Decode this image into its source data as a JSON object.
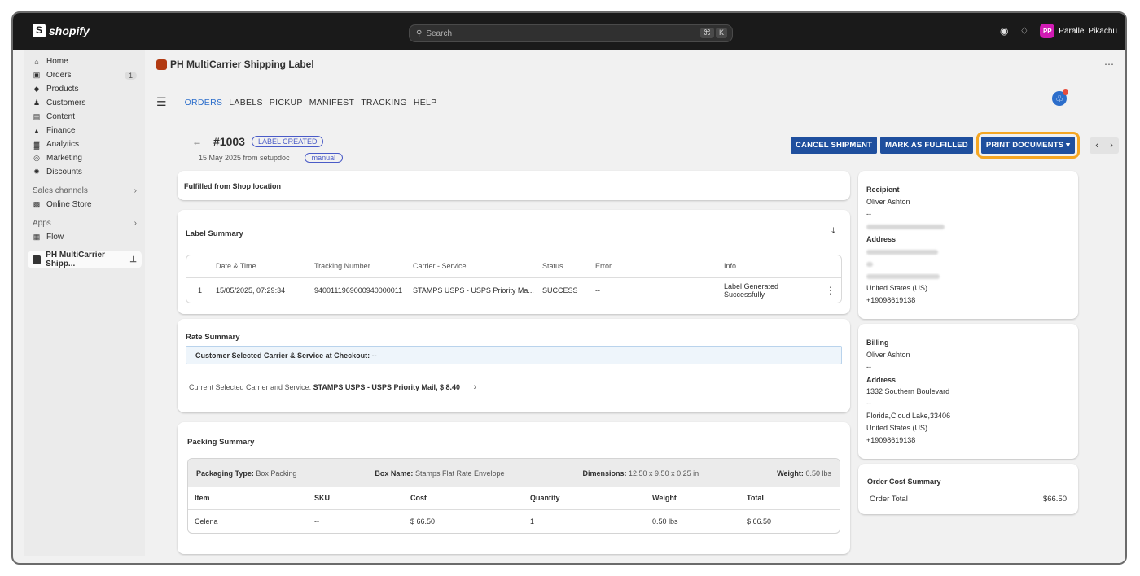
{
  "topbar": {
    "brand": "shopify",
    "search_placeholder": "Search",
    "shortcut_keys": [
      "⌘",
      "K"
    ],
    "user_initials": "PP",
    "user_name": "Parallel Pikachu"
  },
  "sidebar": {
    "items": [
      {
        "label": "Home",
        "icon": "home-icon"
      },
      {
        "label": "Orders",
        "icon": "orders-icon",
        "count": "1"
      },
      {
        "label": "Products",
        "icon": "tag-icon"
      },
      {
        "label": "Customers",
        "icon": "person-icon"
      },
      {
        "label": "Content",
        "icon": "content-icon"
      },
      {
        "label": "Finance",
        "icon": "bank-icon"
      },
      {
        "label": "Analytics",
        "icon": "chart-icon"
      },
      {
        "label": "Marketing",
        "icon": "target-icon"
      },
      {
        "label": "Discounts",
        "icon": "discount-icon"
      }
    ],
    "sales_channels_label": "Sales channels",
    "online_store": "Online Store",
    "apps_label": "Apps",
    "flow": "Flow",
    "active_app": "PH MultiCarrier Shipp..."
  },
  "app": {
    "title": "PH MultiCarrier Shipping Label",
    "menu": [
      "ORDERS",
      "LABELS",
      "PICKUP",
      "MANIFEST",
      "TRACKING",
      "HELP"
    ]
  },
  "order": {
    "id": "#1003",
    "status_badge": "LABEL CREATED",
    "date_line": "15 May 2025 from setupdoc",
    "manual_badge": "manual",
    "actions": [
      "CANCEL SHIPMENT",
      "MARK AS FULFILLED",
      "PRINT DOCUMENTS"
    ]
  },
  "fulfilled": "Fulfilled from Shop location",
  "label_summary": {
    "title": "Label Summary",
    "columns": [
      "Date & Time",
      "Tracking Number",
      "Carrier - Service",
      "Status",
      "Error",
      "Info"
    ],
    "row": {
      "index": "1",
      "datetime": "15/05/2025, 07:29:34",
      "tracking": "9400111969000940000011",
      "carrier": "STAMPS USPS - USPS Priority Ma...",
      "status": "SUCCESS",
      "error": "--",
      "info": "Label Generated Successfully"
    }
  },
  "rate_summary": {
    "title": "Rate Summary",
    "checkout_line": "Customer Selected Carrier & Service at Checkout: --",
    "current_label": "Current Selected Carrier and Service:",
    "current_value": "STAMPS USPS - USPS Priority Mail, $ 8.40"
  },
  "packing_summary": {
    "title": "Packing Summary",
    "packaging_type_label": "Packaging Type:",
    "packaging_type": "Box Packing",
    "box_name_label": "Box Name:",
    "box_name": "Stamps Flat Rate Envelope",
    "dimensions_label": "Dimensions:",
    "dimensions": "12.50 x 9.50 x 0.25 in",
    "weight_label": "Weight:",
    "weight": "0.50 lbs",
    "columns": [
      "Item",
      "SKU",
      "Cost",
      "Quantity",
      "Weight",
      "Total"
    ],
    "row": {
      "item": "Celena",
      "sku": "--",
      "cost": "$ 66.50",
      "quantity": "1",
      "weight": "0.50 lbs",
      "total": "$ 66.50"
    }
  },
  "recipient": {
    "title": "Recipient",
    "name": "Oliver Ashton",
    "dash": "--",
    "address_label": "Address",
    "country": "United States (US)",
    "phone": "+19098619138"
  },
  "billing": {
    "title": "Billing",
    "name": "Oliver Ashton",
    "dash": "--",
    "address_label": "Address",
    "street": "1332 Southern Boulevard",
    "dash2": "--",
    "city_line": "Florida,Cloud Lake,33406",
    "country": "United States (US)",
    "phone": "+19098619138"
  },
  "cost_summary": {
    "title": "Order Cost Summary",
    "total_label": "Order Total",
    "total_value": "$66.50"
  }
}
